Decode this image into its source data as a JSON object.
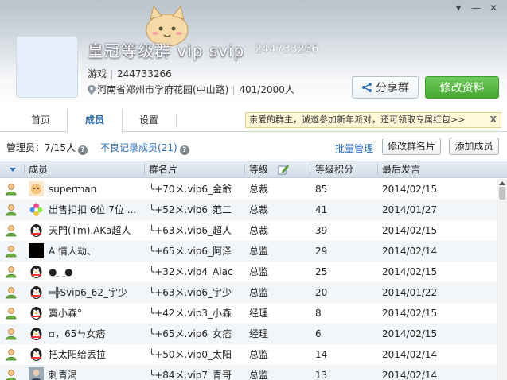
{
  "window": {
    "minimize": "▾",
    "maximize": "—",
    "close": "✕"
  },
  "group": {
    "title": "皇冠等级群 vip svip",
    "id_display": "244733266",
    "category": "游戏",
    "id": "244733266",
    "location": "河南省郑州市学府花园(中山路)",
    "capacity": "401/2000人"
  },
  "actions": {
    "share": "分享群",
    "edit": "修改资料"
  },
  "tabs": [
    {
      "label": "首页"
    },
    {
      "label": "成员"
    },
    {
      "label": "设置"
    }
  ],
  "notice": {
    "text": "亲爱的群主，诚邀参加新年派对，还可领取专属红包>>",
    "close": "X"
  },
  "toolbar": {
    "admins": "管理员：7/15人",
    "bad_records": "不良记录成员(21)",
    "bulk_manage": "批量管理",
    "edit_card": "修改群名片",
    "add_member": "添加成员"
  },
  "columns": {
    "member": "成员",
    "card": "群名片",
    "level": "等级",
    "points": "等级积分",
    "last": "最后发言"
  },
  "members": [
    {
      "name": "superman",
      "card": "╰+70メ.vip6_金爺",
      "level": "总裁",
      "points": "85",
      "last": "2014/02/15",
      "avatar": "cat"
    },
    {
      "name": "出售扣扣 6位 7位 ...",
      "card": "╰+52メ.vip6_范二",
      "level": "总裁",
      "points": "41",
      "last": "2014/01/27",
      "avatar": "flower"
    },
    {
      "name": "天門(Tm).AKa超人",
      "card": "╰+63メ.vip6_超人",
      "level": "总裁",
      "points": "39",
      "last": "2014/02/15",
      "avatar": "penguin"
    },
    {
      "name": "A 情人劫、",
      "card": "╰+65メ.vip6_阿泽",
      "level": "总监",
      "points": "29",
      "last": "2014/02/14",
      "avatar": "black"
    },
    {
      "name": "●‿●",
      "card": "╰+32メ.vip4_Aiac",
      "level": "总监",
      "points": "25",
      "last": "2014/02/15",
      "avatar": "penguin"
    },
    {
      "name": "═╬Svip6_62_宇少",
      "card": "╰+63メ.vip6_宇少",
      "level": "总监",
      "points": "20",
      "last": "2014/01/22",
      "avatar": "penguin"
    },
    {
      "name": "寞小森°",
      "card": "╰+42メ.vip3_小森",
      "level": "经理",
      "points": "8",
      "last": "2014/02/15",
      "avatar": "penguin"
    },
    {
      "name": "▫，65ㄣ女痞",
      "card": "╰+65メ.vip6_女痞",
      "level": "经理",
      "points": "6",
      "last": "2014/02/15",
      "avatar": "penguin"
    },
    {
      "name": "把太阳给丢拉",
      "card": "╰+50メ.vip0_太阳",
      "level": "总监",
      "points": "14",
      "last": "2014/02/14",
      "avatar": "penguin"
    },
    {
      "name": "刺青渴",
      "card": "╰+84メ.vip7_青哥",
      "level": "总监",
      "points": "13",
      "last": "2014/02/14",
      "avatar": "photo"
    }
  ]
}
